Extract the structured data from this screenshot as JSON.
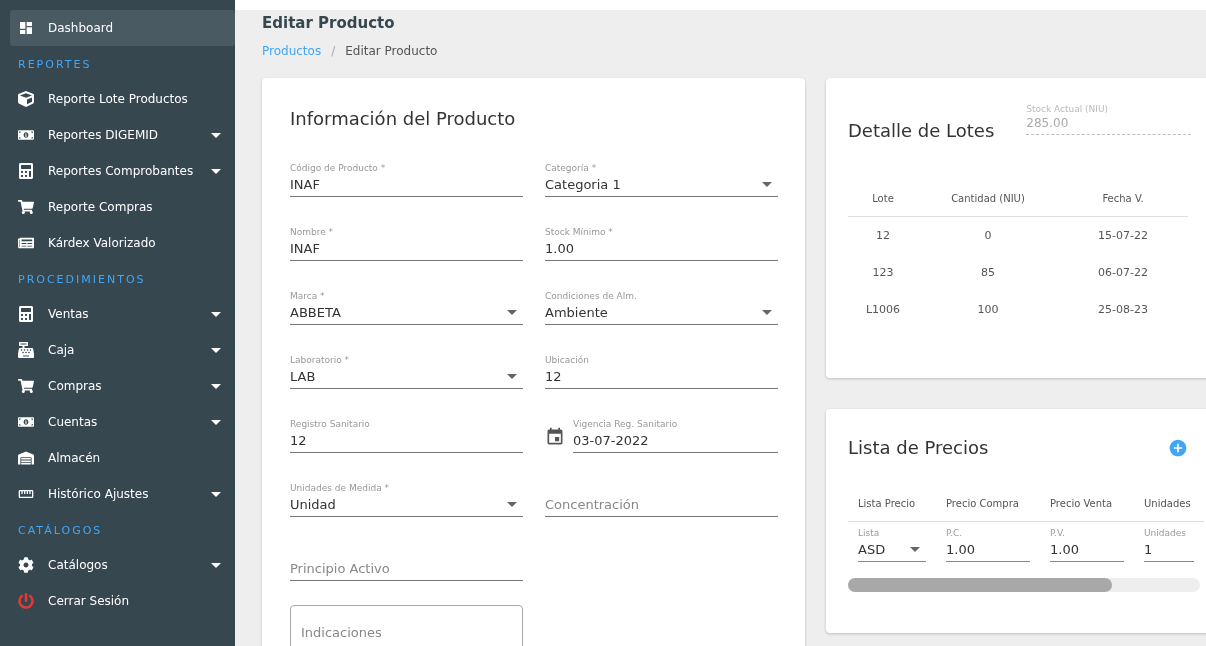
{
  "sidebar": {
    "sections": [
      {
        "items": [
          {
            "label": "Dashboard",
            "selected": true,
            "expandable": false
          }
        ]
      },
      {
        "header": "REPORTES",
        "items": [
          {
            "label": "Reporte Lote Productos",
            "selected": false,
            "expandable": false
          },
          {
            "label": "Reportes DIGEMID",
            "selected": false,
            "expandable": true
          },
          {
            "label": "Reportes Comprobantes",
            "selected": false,
            "expandable": true
          },
          {
            "label": "Reporte Compras",
            "selected": false,
            "expandable": false
          },
          {
            "label": "Kárdex Valorizado",
            "selected": false,
            "expandable": false
          }
        ]
      },
      {
        "header": "PROCEDIMIENTOS",
        "items": [
          {
            "label": "Ventas",
            "selected": false,
            "expandable": true
          },
          {
            "label": "Caja",
            "selected": false,
            "expandable": true
          },
          {
            "label": "Compras",
            "selected": false,
            "expandable": true
          },
          {
            "label": "Cuentas",
            "selected": false,
            "expandable": true
          },
          {
            "label": "Almacén",
            "selected": false,
            "expandable": false
          },
          {
            "label": "Histórico Ajustes",
            "selected": false,
            "expandable": true
          }
        ]
      },
      {
        "header": "CATÁLOGOS",
        "items": [
          {
            "label": "Catálogos",
            "selected": false,
            "expandable": true
          },
          {
            "label": "Cerrar Sesión",
            "selected": false,
            "expandable": false
          }
        ]
      }
    ]
  },
  "page": {
    "title": "Editar Producto",
    "separator": "/",
    "breadcrumb": [
      {
        "label": "Productos",
        "link": true
      },
      {
        "label": "Editar Producto",
        "link": false
      }
    ]
  },
  "product_card": {
    "title": "Información del Producto",
    "fields": [
      {
        "kind": "text",
        "label": "Código de Producto *",
        "value": "INAF"
      },
      {
        "kind": "select",
        "label": "Categoría *",
        "value": "Categoria 1"
      },
      {
        "kind": "text",
        "label": "Nombre *",
        "value": "INAF"
      },
      {
        "kind": "text",
        "label": "Stock Mínimo *",
        "value": "1.00"
      },
      {
        "kind": "select",
        "label": "Marca *",
        "value": "ABBETA"
      },
      {
        "kind": "select",
        "label": "Condiciones de Alm.",
        "value": "Ambiente"
      },
      {
        "kind": "select",
        "label": "Laboratorio *",
        "value": "LAB"
      },
      {
        "kind": "text",
        "label": "Ubicación",
        "value": "12"
      },
      {
        "kind": "text",
        "label": "Registro Sanitario",
        "value": "12"
      },
      {
        "kind": "date",
        "label": "Vigencia Reg. Sanitario",
        "value": "03-07-2022"
      },
      {
        "kind": "select",
        "label": "Unidades de Medida *",
        "value": "Unidad"
      },
      {
        "kind": "empty",
        "placeholder": "Concentración"
      },
      {
        "kind": "empty",
        "placeholder": "Principio Activo"
      },
      {
        "kind": "blank"
      },
      {
        "kind": "textarea",
        "placeholder": "Indicaciones"
      }
    ]
  },
  "lots_card": {
    "title": "Detalle de Lotes",
    "stock": {
      "label": "Stock Actual (NIU)",
      "value": "285.00"
    },
    "columns": [
      "Lote",
      "Cantidad (NIU)",
      "Fecha V."
    ],
    "rows": [
      [
        "12",
        "0",
        "15-07-22"
      ],
      [
        "123",
        "85",
        "06-07-22"
      ],
      [
        "L1006",
        "100",
        "25-08-23"
      ]
    ]
  },
  "prices_card": {
    "title": "Lista de Precios",
    "columns": [
      "Lista Precio",
      "Precio Compra",
      "Precio Venta",
      "Unidades"
    ],
    "rows": [
      [
        {
          "kind": "select",
          "label": "Lista",
          "value": "ASD"
        },
        {
          "kind": "text",
          "label": "P.C.",
          "value": "1.00"
        },
        {
          "kind": "text",
          "label": "P.V.",
          "value": "1.00"
        },
        {
          "kind": "text",
          "label": "Unidades",
          "value": "1"
        }
      ]
    ]
  }
}
